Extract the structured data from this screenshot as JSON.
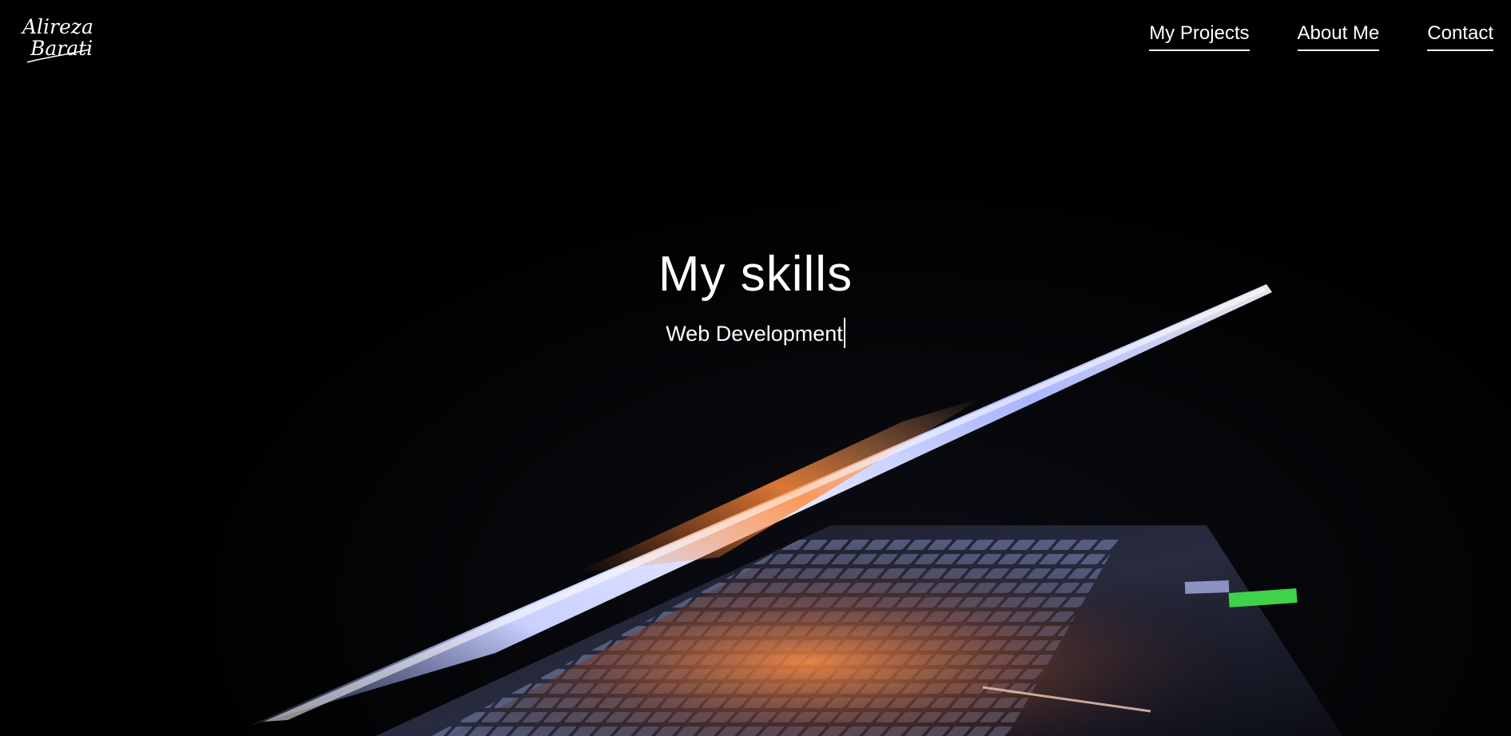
{
  "logo": {
    "line1": "Alireza",
    "line2": "Barati"
  },
  "nav": {
    "items": [
      {
        "label": "My Projects"
      },
      {
        "label": "About Me"
      },
      {
        "label": "Contact"
      }
    ]
  },
  "hero": {
    "title": "My skills",
    "subtitle": "Web Development"
  },
  "colors": {
    "background": "#000000",
    "text": "#ffffff",
    "screen_glow": "#b9c3ff",
    "keyboard_glow": "#ff8a3d",
    "led_green": "#3fd24a"
  }
}
